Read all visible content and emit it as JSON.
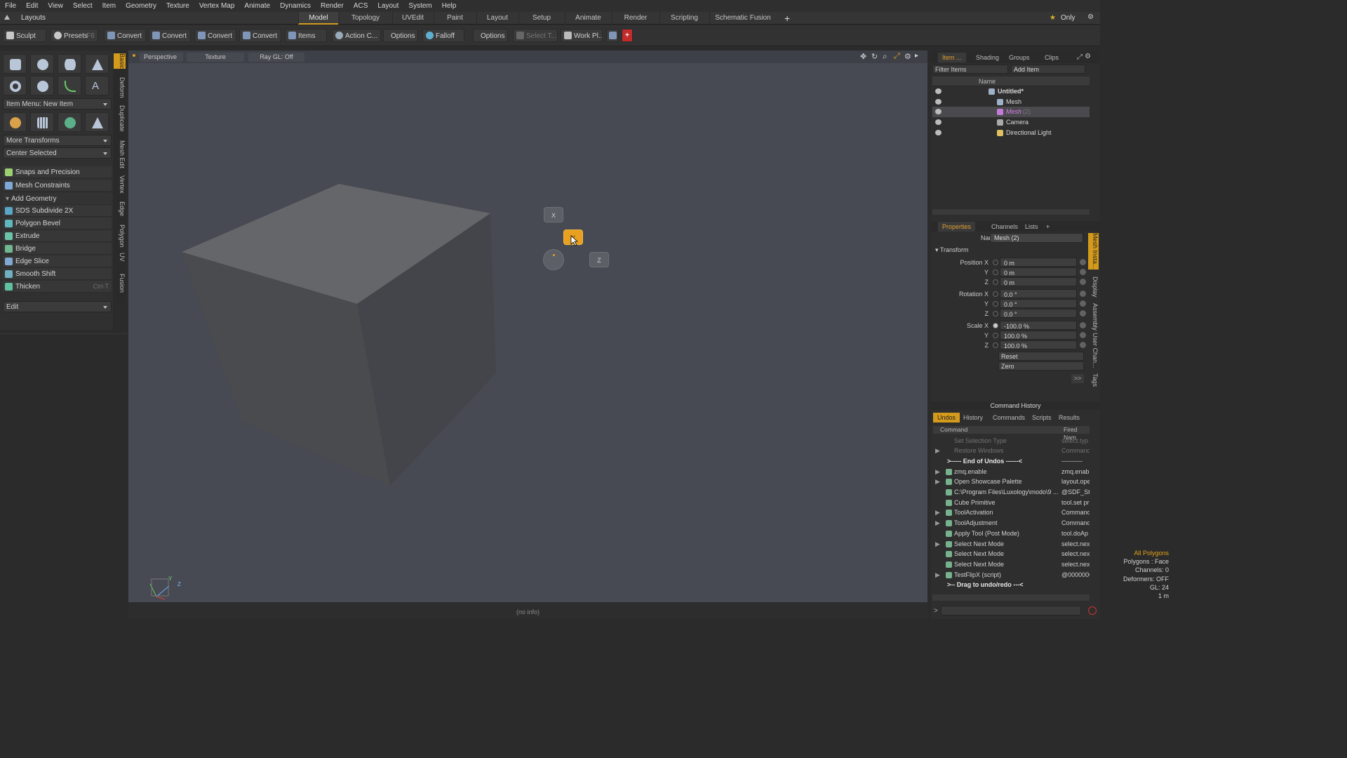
{
  "menubar": {
    "items": [
      "File",
      "Edit",
      "View",
      "Select",
      "Item",
      "Geometry",
      "Texture",
      "Vertex Map",
      "Animate",
      "Dynamics",
      "Render",
      "ACS",
      "Layout",
      "System",
      "Help"
    ]
  },
  "layoutbar": {
    "title": "Layouts",
    "tabs": [
      "Model",
      "Topology",
      "UVEdit",
      "Paint",
      "Layout",
      "Setup",
      "Animate",
      "Render",
      "Scripting",
      "Schematic Fusion"
    ],
    "plus": "+",
    "only": "Only"
  },
  "toolbar": {
    "sculpt": "Sculpt",
    "presets": "Presets",
    "presets_key": "F6",
    "convert": "Convert",
    "items": "Items",
    "action_center": "Action C...",
    "options": "Options",
    "falloff": "Falloff",
    "select_tool": "Select T...",
    "work_plane": "Work Pl..."
  },
  "leftpanel": {
    "item_menu": "Item Menu: New Item",
    "more_transforms": "More Transforms",
    "center_selected": "Center Selected",
    "snaps": "Snaps and Precision",
    "mesh_constraints": "Mesh Constraints",
    "add_geometry": "Add Geometry",
    "tools": [
      {
        "label": "SDS Subdivide 2X",
        "key": ""
      },
      {
        "label": "Polygon Bevel",
        "key": ""
      },
      {
        "label": "Extrude",
        "key": ""
      },
      {
        "label": "Bridge",
        "key": ""
      },
      {
        "label": "Edge Slice",
        "key": ""
      },
      {
        "label": "Smooth Shift",
        "key": ""
      },
      {
        "label": "Thicken",
        "key": "Ctrl-T"
      }
    ],
    "edit": "Edit",
    "vtabs": [
      "Basic",
      "Deform",
      "Duplicate",
      "Mesh Edit",
      "Vertex",
      "Edge",
      "Polygon",
      "UV",
      "Fusion"
    ]
  },
  "viewport": {
    "tabs": [
      "Perspective",
      "Texture",
      "Ray GL: Off"
    ],
    "info": [
      "All Polygons",
      "Polygons : Face",
      "Channels: 0",
      "Deformers: OFF",
      "GL: 24",
      "1 m"
    ],
    "status": "(no info)",
    "pie": {
      "x": "X",
      "y": "Y",
      "z": "Z"
    },
    "axis": {
      "y": "Y",
      "z": "Z"
    }
  },
  "outliner": {
    "tabs": [
      "Item ...",
      "Shading",
      "Groups",
      "Clips"
    ],
    "filter": "Filter Items",
    "add_item": "Add Item",
    "header": "Name",
    "rows": [
      {
        "name": "Untitled*",
        "kind": "scene"
      },
      {
        "name": "Mesh",
        "kind": "mesh"
      },
      {
        "name": "Mesh",
        "suffix": "(2)",
        "kind": "mesh-selected"
      },
      {
        "name": "Camera",
        "kind": "camera"
      },
      {
        "name": "Directional Light",
        "kind": "light"
      }
    ]
  },
  "properties": {
    "tabs": [
      "Properties",
      "Channels",
      "Lists"
    ],
    "plus": "+",
    "name_label": "Name",
    "name_value": "Mesh (2)",
    "transform": "Transform",
    "rows": [
      {
        "label": "Position X",
        "value": "0 m"
      },
      {
        "label": "Y",
        "value": "0 m"
      },
      {
        "label": "Z",
        "value": "0 m"
      },
      {
        "label": "Rotation X",
        "value": "0.0 °"
      },
      {
        "label": "Y",
        "value": "0.0 °"
      },
      {
        "label": "Z",
        "value": "0.0 °"
      },
      {
        "label": "Scale X",
        "value": "-100.0 %"
      },
      {
        "label": "Y",
        "value": "100.0 %"
      },
      {
        "label": "Z",
        "value": "100.0 %"
      }
    ],
    "reset": "Reset",
    "zero": "Zero",
    "more": ">>",
    "side_tabs": [
      "Mesh Insta...",
      "Display",
      "Assembly",
      "User Chan...",
      "Tags"
    ]
  },
  "history": {
    "title": "Command History",
    "tabs": [
      "Undos",
      "History",
      "Commands",
      "Scripts",
      "Results"
    ],
    "columns": [
      "Command",
      "Fired Nam"
    ],
    "rows": [
      {
        "cmd": "Set Selection Type",
        "fn": "select.typ",
        "style": "dim",
        "arrow": ""
      },
      {
        "cmd": "Restore Windows",
        "fn": "Command",
        "style": "dim",
        "arrow": "▶"
      },
      {
        "cmd": ">----- End of Undos ------<",
        "fn": "----------",
        "style": "bold",
        "arrow": ""
      },
      {
        "cmd": "zmq.enable",
        "fn": "zmq.enabl",
        "style": "",
        "arrow": "▶"
      },
      {
        "cmd": "Open Showcase Palette",
        "fn": "layout.ope",
        "style": "",
        "arrow": "▶"
      },
      {
        "cmd": "C:\\Program Files\\Luxology\\modo\\9 ...",
        "fn": "@SDF_Str",
        "style": "",
        "arrow": ""
      },
      {
        "cmd": "Cube Primitive",
        "fn": "tool.set pr",
        "style": "",
        "arrow": ""
      },
      {
        "cmd": "ToolActivation",
        "fn": "Command",
        "style": "",
        "arrow": "▶"
      },
      {
        "cmd": "ToolAdjustment",
        "fn": "Command",
        "style": "",
        "arrow": "▶"
      },
      {
        "cmd": "Apply Tool (Post Mode)",
        "fn": "tool.doAp",
        "style": "",
        "arrow": ""
      },
      {
        "cmd": "Select Next Mode",
        "fn": "select.nex",
        "style": "",
        "arrow": "▶"
      },
      {
        "cmd": "Select Next Mode",
        "fn": "select.nex",
        "style": "",
        "arrow": ""
      },
      {
        "cmd": "Select Next Mode",
        "fn": "select.nex",
        "style": "",
        "arrow": ""
      },
      {
        "cmd": "TestFlipX (script)",
        "fn": "@0000000",
        "style": "",
        "arrow": "▶"
      },
      {
        "cmd": ">-- Drag to undo/redo ---<",
        "fn": "",
        "style": "bold",
        "arrow": ""
      }
    ],
    "prompt": ">"
  },
  "colors": {
    "accent": "#e0a030",
    "viewport_bg": "#474a52",
    "panel_bg": "#2e2e2e"
  }
}
